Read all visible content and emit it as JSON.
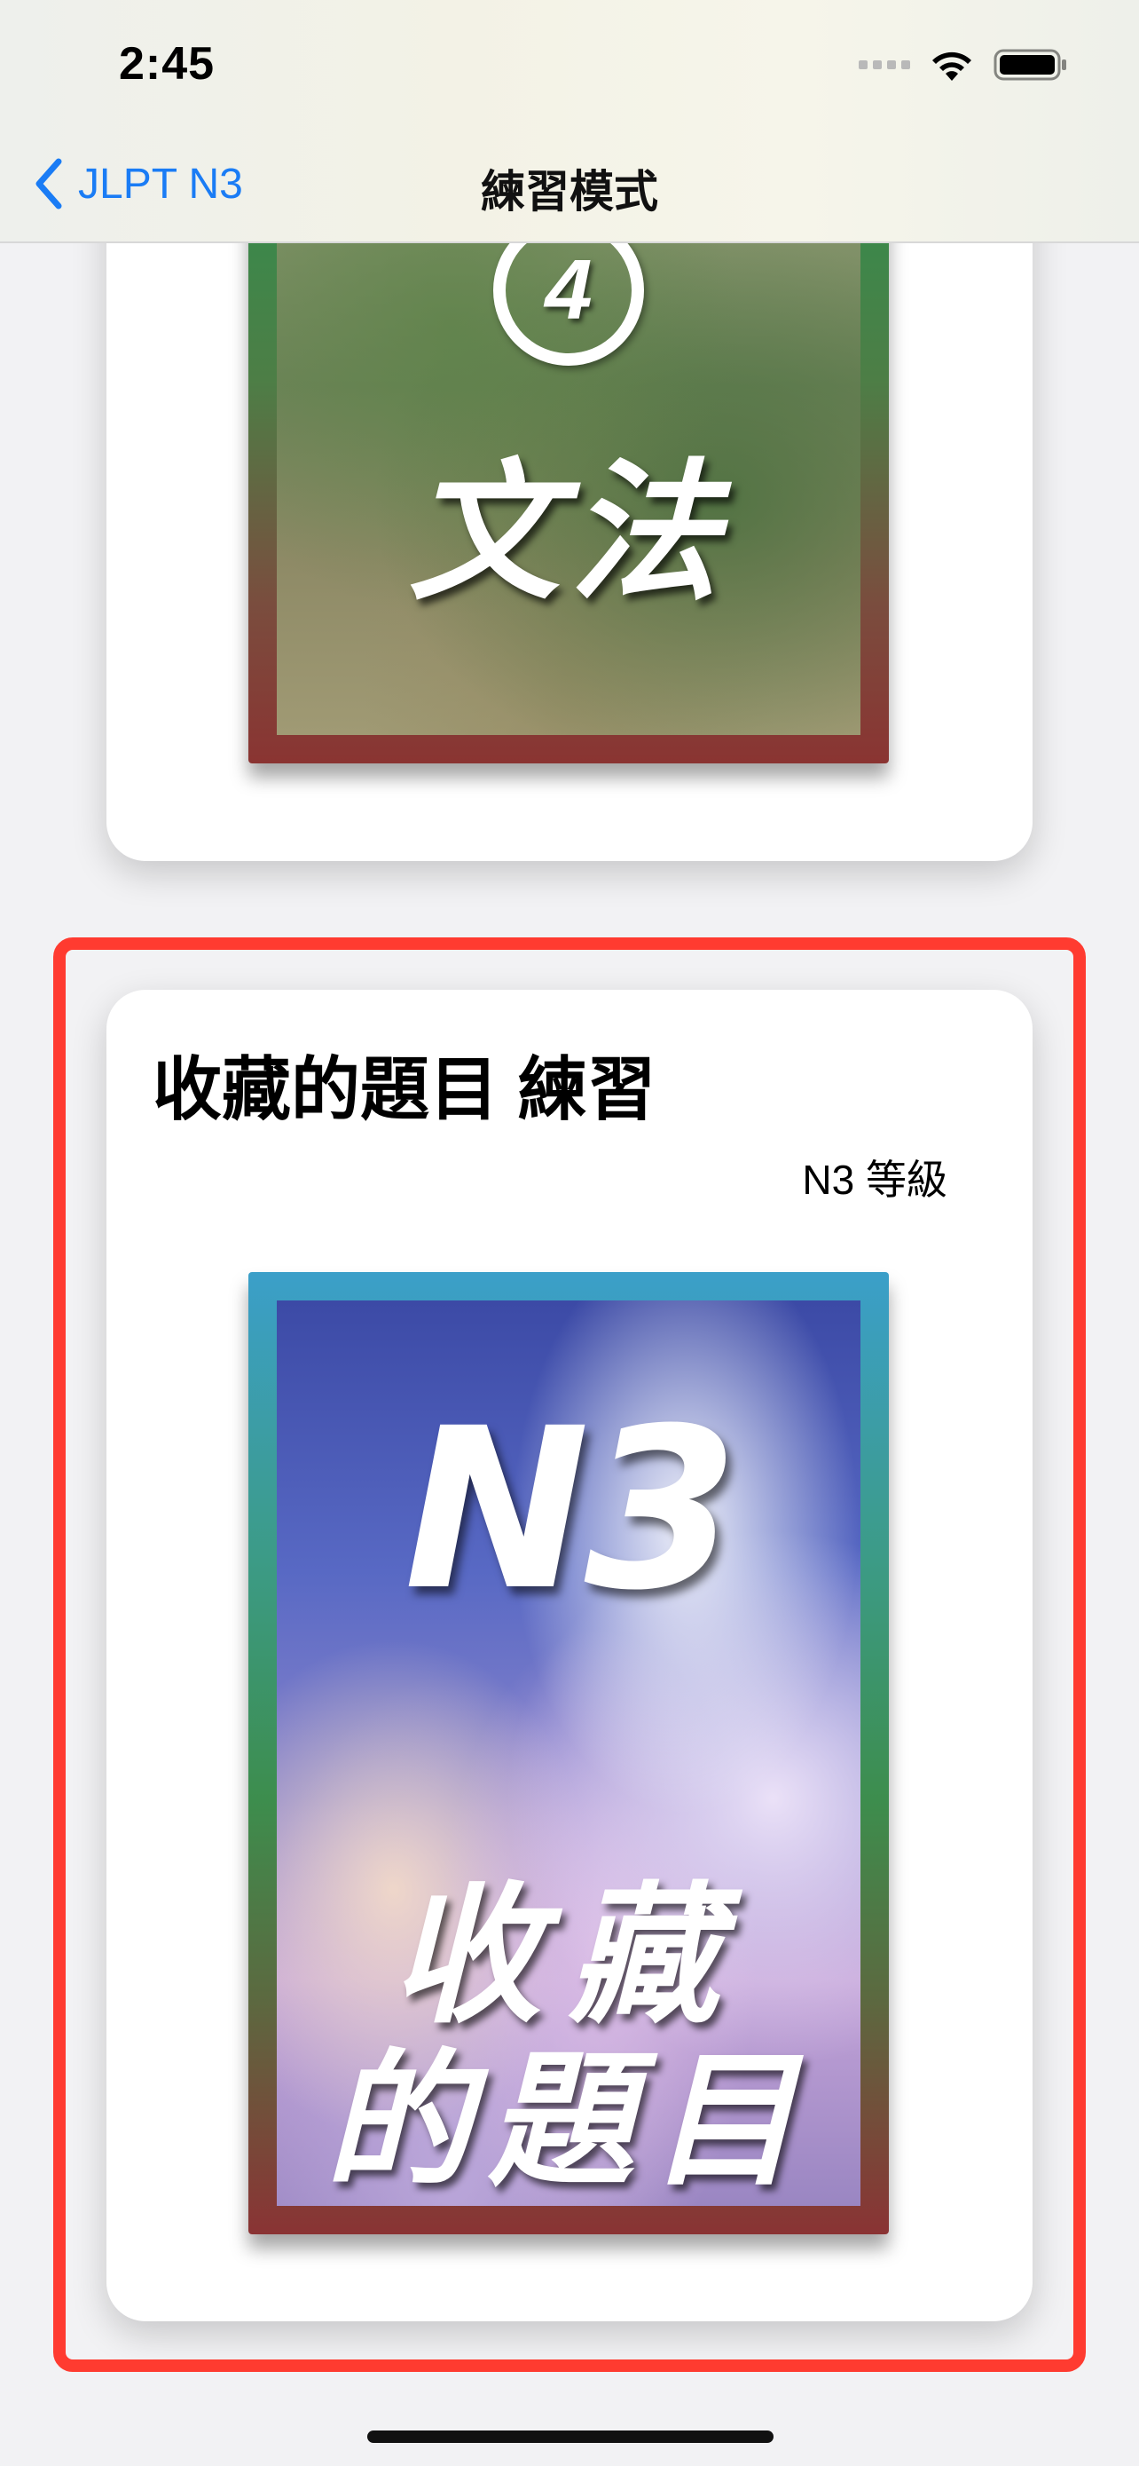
{
  "status_bar": {
    "time": "2:45",
    "icons": [
      "signal-icon",
      "wifi-icon",
      "battery-icon"
    ]
  },
  "nav": {
    "back_label": "JLPT N3",
    "title": "練習模式"
  },
  "grammar_card": {
    "cover_number": "4",
    "cover_word": "文法"
  },
  "favorites_card": {
    "title": "收藏的題目 練習",
    "level": "N3 等級",
    "cover_level": "N3",
    "cover_line1": "收藏",
    "cover_line2": "的題目"
  },
  "colors": {
    "accent": "#1a7cf5",
    "highlight": "#ff3b30"
  }
}
